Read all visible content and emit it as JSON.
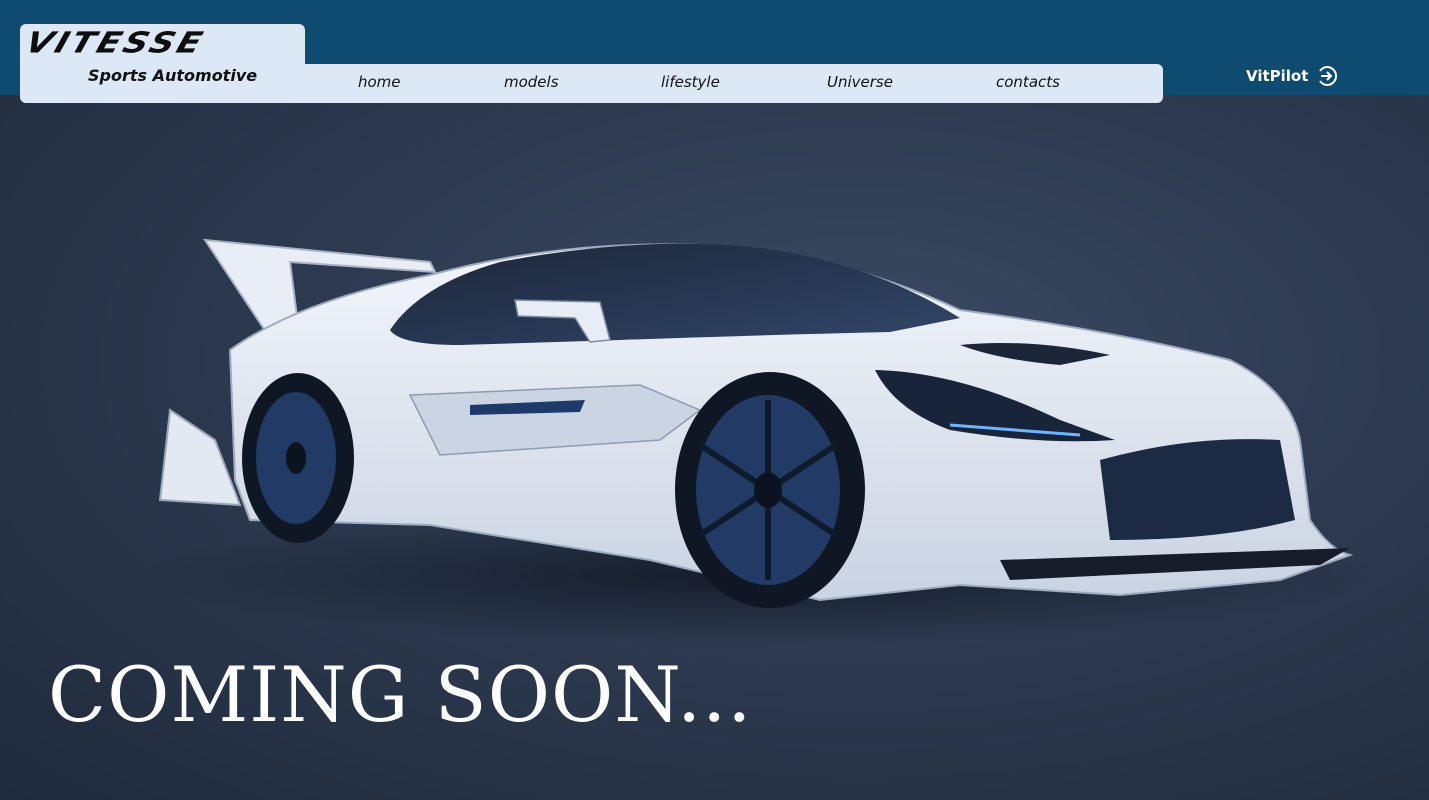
{
  "brand": {
    "logo_text": "VITESSE",
    "tagline": "Sports Automotive"
  },
  "nav": {
    "items": [
      {
        "label": "home"
      },
      {
        "label": "models"
      },
      {
        "label": "lifestyle"
      },
      {
        "label": "Universe"
      },
      {
        "label": "contacts"
      }
    ]
  },
  "account": {
    "label": "VitPilot",
    "icon": "login-icon"
  },
  "hero": {
    "headline": "COMING SOON...",
    "image": "white-concept-sports-car"
  },
  "colors": {
    "header_bg": "#0f4b70",
    "nav_bg": "#dde8f7",
    "hero_bg": "#2d3a50",
    "headline": "#ffffff"
  }
}
